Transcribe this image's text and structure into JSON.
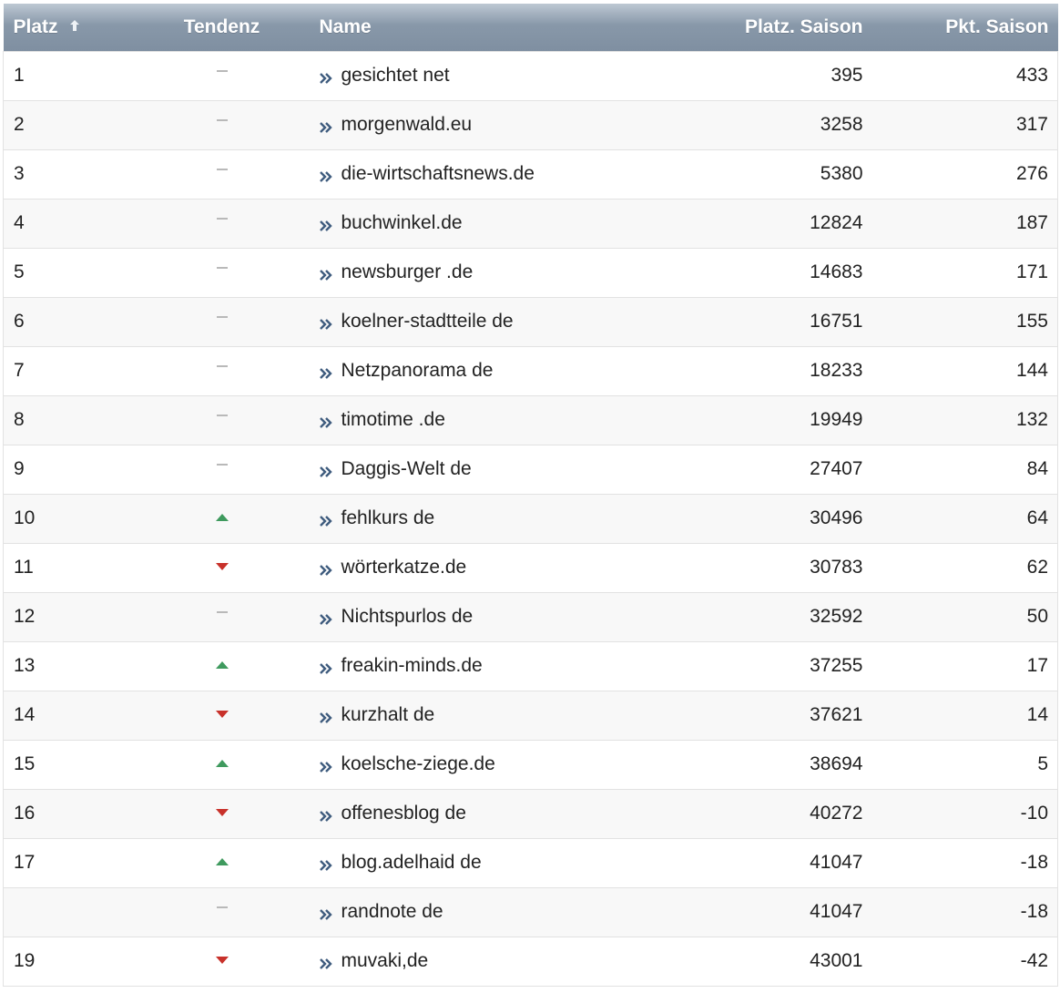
{
  "colors": {
    "header_gradient_top": "#bdc8d3",
    "header_gradient_bottom": "#7f8fa1",
    "tendency_up": "#3f9a5e",
    "tendency_down": "#c8312a",
    "tendency_same": "#b9b9b9",
    "link_icon": "#3f5c7e"
  },
  "table": {
    "headers": {
      "platz": "Platz",
      "platz_sort_icon": "sort-ascending-arrow-icon",
      "tendenz": "Tendenz",
      "name": "Name",
      "platz_saison": "Platz. Saison",
      "pkt_saison": "Pkt. Saison"
    },
    "rows": [
      {
        "platz": "1",
        "tendenz": "same",
        "name": "gesichtet net",
        "platz_saison": "395",
        "pkt_saison": "433"
      },
      {
        "platz": "2",
        "tendenz": "same",
        "name": "morgenwald.eu",
        "platz_saison": "3258",
        "pkt_saison": "317"
      },
      {
        "platz": "3",
        "tendenz": "same",
        "name": "die-wirtschaftsnews.de",
        "platz_saison": "5380",
        "pkt_saison": "276"
      },
      {
        "platz": "4",
        "tendenz": "same",
        "name": "buchwinkel.de",
        "platz_saison": "12824",
        "pkt_saison": "187"
      },
      {
        "platz": "5",
        "tendenz": "same",
        "name": "newsburger .de",
        "platz_saison": "14683",
        "pkt_saison": "171"
      },
      {
        "platz": "6",
        "tendenz": "same",
        "name": "koelner-stadtteile de",
        "platz_saison": "16751",
        "pkt_saison": "155"
      },
      {
        "platz": "7",
        "tendenz": "same",
        "name": "Netzpanorama de",
        "platz_saison": "18233",
        "pkt_saison": "144"
      },
      {
        "platz": "8",
        "tendenz": "same",
        "name": "timotime .de",
        "platz_saison": "19949",
        "pkt_saison": "132"
      },
      {
        "platz": "9",
        "tendenz": "same",
        "name": "Daggis-Welt de",
        "platz_saison": "27407",
        "pkt_saison": "84"
      },
      {
        "platz": "10",
        "tendenz": "up",
        "name": "fehlkurs de",
        "platz_saison": "30496",
        "pkt_saison": "64"
      },
      {
        "platz": "11",
        "tendenz": "down",
        "name": "wörterkatze.de",
        "platz_saison": "30783",
        "pkt_saison": "62"
      },
      {
        "platz": "12",
        "tendenz": "same",
        "name": "Nichtspurlos de",
        "platz_saison": "32592",
        "pkt_saison": "50"
      },
      {
        "platz": "13",
        "tendenz": "up",
        "name": "freakin-minds.de",
        "platz_saison": "37255",
        "pkt_saison": "17"
      },
      {
        "platz": "14",
        "tendenz": "down",
        "name": "kurzhalt de",
        "platz_saison": "37621",
        "pkt_saison": "14"
      },
      {
        "platz": "15",
        "tendenz": "up",
        "name": "koelsche-ziege.de",
        "platz_saison": "38694",
        "pkt_saison": "5"
      },
      {
        "platz": "16",
        "tendenz": "down",
        "name": "offenesblog de",
        "platz_saison": "40272",
        "pkt_saison": "-10"
      },
      {
        "platz": "17",
        "tendenz": "up",
        "name": "blog.adelhaid de",
        "platz_saison": "41047",
        "pkt_saison": "-18"
      },
      {
        "platz": "",
        "tendenz": "same",
        "name": "randnote de",
        "platz_saison": "41047",
        "pkt_saison": "-18"
      },
      {
        "platz": "19",
        "tendenz": "down",
        "name": "muvaki,de",
        "platz_saison": "43001",
        "pkt_saison": "-42"
      }
    ]
  }
}
